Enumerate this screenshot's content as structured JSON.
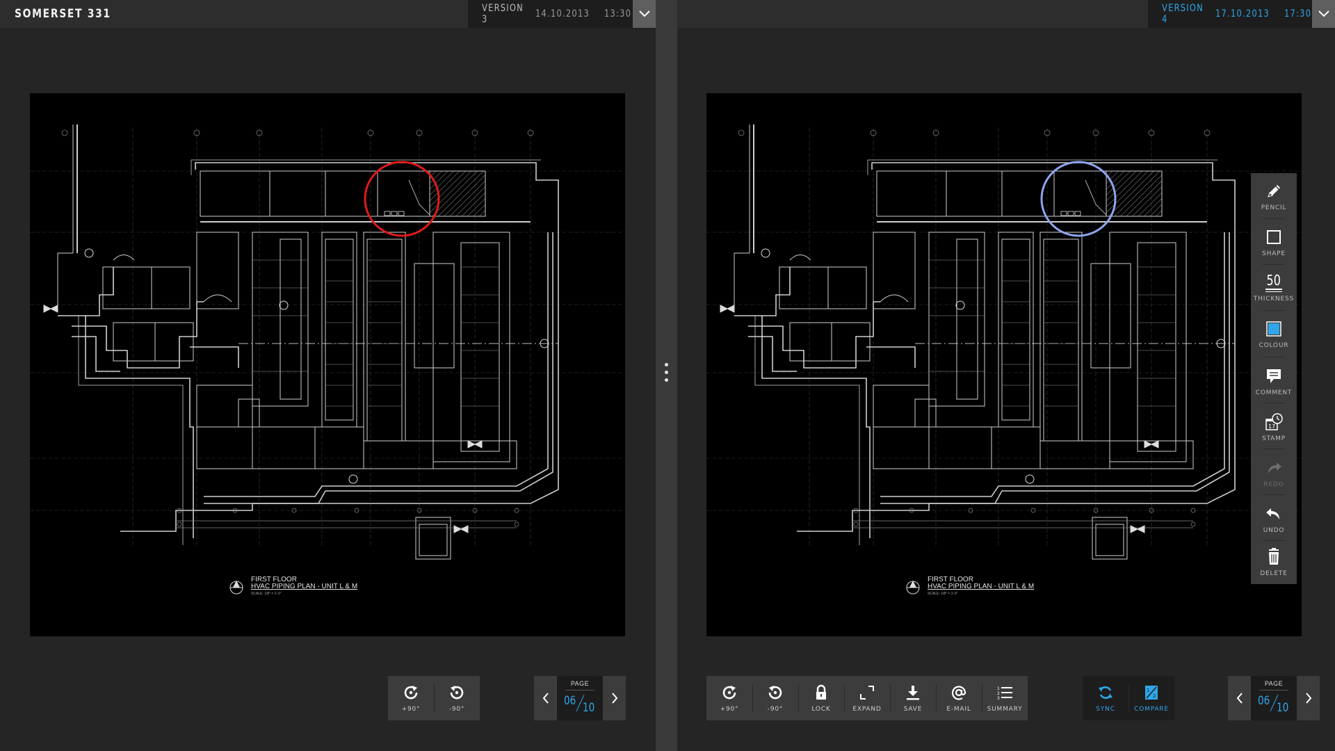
{
  "app": {
    "title": "SOMERSET 331"
  },
  "left": {
    "version": {
      "label": "VERSION 3",
      "date": "14.10.2013",
      "time": "13:30",
      "color": "#bcbcbc"
    },
    "markup_circle_color": "#e01b1b",
    "toolbar": [
      {
        "icon": "rotate-cw-icon",
        "label": "+90°"
      },
      {
        "icon": "rotate-ccw-icon",
        "label": "-90°"
      }
    ],
    "page": {
      "label": "PAGE",
      "current": "06",
      "total": "10"
    }
  },
  "right": {
    "version": {
      "label": "VERSION 4",
      "date": "17.10.2013",
      "time": "17:30",
      "color": "#2fa6ea"
    },
    "markup_circle_color": "#8fa6f0",
    "toolbar": [
      {
        "icon": "rotate-cw-icon",
        "label": "+90°"
      },
      {
        "icon": "rotate-ccw-icon",
        "label": "-90°"
      },
      {
        "icon": "lock-icon",
        "label": "LOCK"
      },
      {
        "icon": "expand-icon",
        "label": "EXPAND"
      },
      {
        "icon": "save-icon",
        "label": "SAVE"
      },
      {
        "icon": "email-icon",
        "label": "E-MAIL"
      },
      {
        "icon": "summary-icon",
        "label": "SUMMARY"
      }
    ],
    "compare_tools": [
      {
        "icon": "sync-icon",
        "label": "SYNC"
      },
      {
        "icon": "compare-icon",
        "label": "COMPARE"
      }
    ],
    "page": {
      "label": "PAGE",
      "current": "06",
      "total": "10"
    },
    "annotation_tools": [
      {
        "icon": "pencil-icon",
        "label": "PENCIL",
        "enabled": true
      },
      {
        "icon": "shape-icon",
        "label": "SHAPE",
        "enabled": true
      },
      {
        "icon": "thickness-icon",
        "label": "THICKNESS",
        "value": "50",
        "enabled": true
      },
      {
        "icon": "colour-icon",
        "label": "COLOUR",
        "swatch": "#2fa6ea",
        "enabled": true
      },
      {
        "icon": "comment-icon",
        "label": "COMMENT",
        "enabled": true
      },
      {
        "icon": "stamp-icon",
        "label": "STAMP",
        "stamp_number": "17",
        "enabled": true
      },
      {
        "icon": "redo-icon",
        "label": "REDO",
        "enabled": false
      },
      {
        "icon": "undo-icon",
        "label": "UNDO",
        "enabled": true
      },
      {
        "icon": "delete-icon",
        "label": "DELETE",
        "enabled": true
      }
    ]
  },
  "drawing": {
    "title_line1": "FIRST FLOOR",
    "title_line2": "HVAC PIPING PLAN - UNIT L & M",
    "scale": "SCALE: 1/8\" = 1'-0\""
  },
  "colors": {
    "accent": "#2fa6ea",
    "panel": "#3c3c3c",
    "canvas": "#000000"
  }
}
